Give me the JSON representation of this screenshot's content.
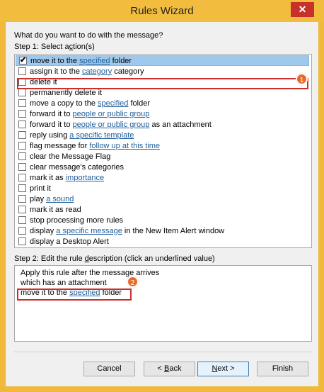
{
  "window": {
    "title": "Rules Wizard",
    "close_glyph": "✕"
  },
  "prompt": "What do you want to do with the message?",
  "step1": {
    "label_pre": "Step 1: Select a",
    "label_ul": "c",
    "label_post": "tion(s)",
    "actions": [
      {
        "pre": "move it to the ",
        "link": "specified",
        "post": " folder",
        "checked": true
      },
      {
        "pre": "assign it to the ",
        "link": "category",
        "post": " category",
        "checked": false
      },
      {
        "pre": "delete it",
        "link": "",
        "post": "",
        "checked": false
      },
      {
        "pre": "permanently delete it",
        "link": "",
        "post": "",
        "checked": false
      },
      {
        "pre": "move a copy to the ",
        "link": "specified",
        "post": " folder",
        "checked": false
      },
      {
        "pre": "forward it to ",
        "link": "people or public group",
        "post": "",
        "checked": false
      },
      {
        "pre": "forward it to ",
        "link": "people or public group",
        "post": " as an attachment",
        "checked": false
      },
      {
        "pre": "reply using ",
        "link": "a specific template",
        "post": "",
        "checked": false
      },
      {
        "pre": "flag message for ",
        "link": "follow up at this time",
        "post": "",
        "checked": false
      },
      {
        "pre": "clear the Message Flag",
        "link": "",
        "post": "",
        "checked": false
      },
      {
        "pre": "clear message's categories",
        "link": "",
        "post": "",
        "checked": false
      },
      {
        "pre": "mark it as ",
        "link": "importance",
        "post": "",
        "checked": false
      },
      {
        "pre": "print it",
        "link": "",
        "post": "",
        "checked": false
      },
      {
        "pre": "play ",
        "link": "a sound",
        "post": "",
        "checked": false
      },
      {
        "pre": "mark it as read",
        "link": "",
        "post": "",
        "checked": false
      },
      {
        "pre": "stop processing more rules",
        "link": "",
        "post": "",
        "checked": false
      },
      {
        "pre": "display ",
        "link": "a specific message",
        "post": " in the New Item Alert window",
        "checked": false
      },
      {
        "pre": "display a Desktop Alert",
        "link": "",
        "post": "",
        "checked": false
      }
    ]
  },
  "step2": {
    "label_pre": "Step 2: Edit the rule ",
    "label_ul": "d",
    "label_post": "escription (click an underlined value)",
    "lines": [
      {
        "pre": "Apply this rule after the message arrives",
        "link": "",
        "post": ""
      },
      {
        "pre": "which has an attachment",
        "link": "",
        "post": ""
      },
      {
        "pre": "move it to the ",
        "link": "specified",
        "post": " folder"
      }
    ]
  },
  "badges": {
    "one": "1",
    "two": "2"
  },
  "buttons": {
    "cancel": "Cancel",
    "back_pre": "< ",
    "back_ul": "B",
    "back_post": "ack",
    "next_ul": "N",
    "next_post": "ext >",
    "finish": "Finish"
  },
  "colors": {
    "frame": "#f2bd3f",
    "highlight": "#c9302c",
    "link": "#1f5e99",
    "selection": "#9fc9ec",
    "badge": "#e46b2c"
  }
}
